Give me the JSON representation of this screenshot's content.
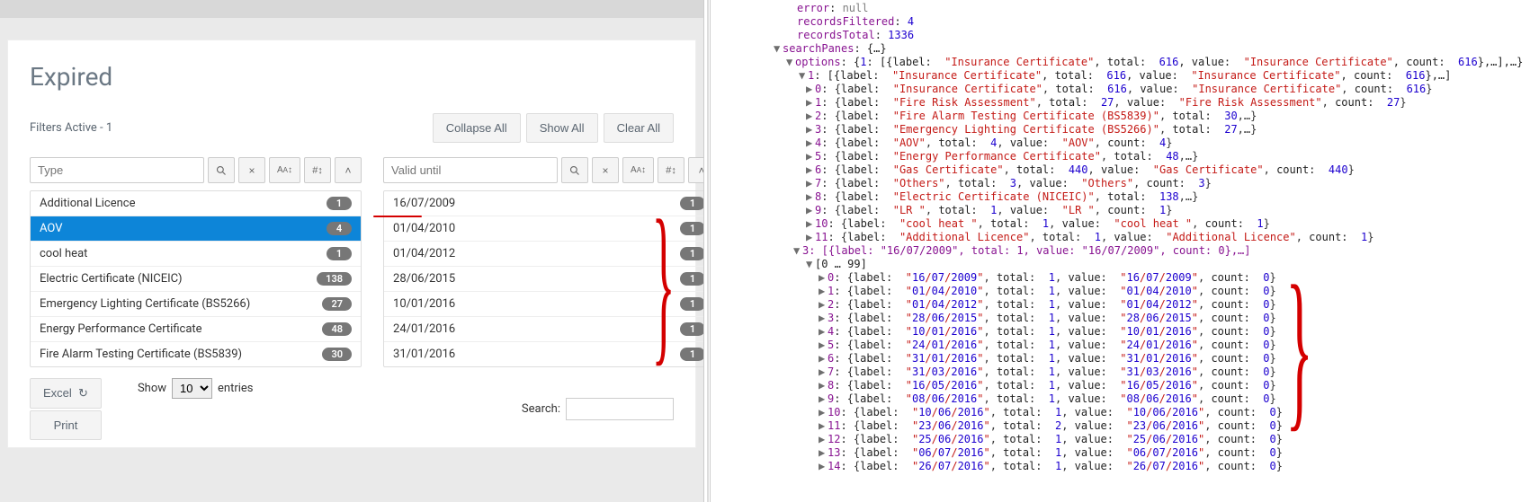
{
  "page": {
    "title": "Expired",
    "filters_active_label": "Filters Active - 1",
    "buttons": {
      "collapse": "Collapse All",
      "show": "Show All",
      "clear": "Clear All"
    }
  },
  "panes": {
    "type": {
      "placeholder": "Type",
      "items": [
        {
          "label": "Additional Licence",
          "count": 1
        },
        {
          "label": "AOV",
          "count": 4,
          "selected": true
        },
        {
          "label": "cool heat",
          "count": 1
        },
        {
          "label": "Electric Certificate (NICEIC)",
          "count": 138
        },
        {
          "label": "Emergency Lighting Certificate (BS5266)",
          "count": 27
        },
        {
          "label": "Energy Performance Certificate",
          "count": 48
        },
        {
          "label": "Fire Alarm Testing Certificate (BS5839)",
          "count": 30
        }
      ]
    },
    "valid": {
      "placeholder": "Valid until",
      "items": [
        {
          "label": "16/07/2009",
          "count": 1
        },
        {
          "label": "01/04/2010",
          "count": 1
        },
        {
          "label": "01/04/2012",
          "count": 1
        },
        {
          "label": "28/06/2015",
          "count": 1
        },
        {
          "label": "10/01/2016",
          "count": 1
        },
        {
          "label": "24/01/2016",
          "count": 1
        },
        {
          "label": "31/01/2016",
          "count": 1
        }
      ]
    },
    "sort_icons": {
      "clear": "×",
      "alpha": "A",
      "num": "#",
      "arrow": "˄"
    }
  },
  "table": {
    "excel": "Excel",
    "print": "Print",
    "show": "Show",
    "entries": "entries",
    "page_sizes": [
      "10"
    ],
    "search": "Search:"
  },
  "json": {
    "top": [
      {
        "indent": 4,
        "k": "error",
        "v": "null",
        "t": "null"
      },
      {
        "indent": 4,
        "k": "recordsFiltered",
        "v": "4",
        "t": "num"
      },
      {
        "indent": 4,
        "k": "recordsTotal",
        "v": "1336",
        "t": "num"
      },
      {
        "indent": 3,
        "arrow": "▼",
        "k": "searchPanes",
        "suffix": ": {…}"
      },
      {
        "indent": 4,
        "arrow": "▼",
        "k": "options",
        "suffix": ": {1: [{label: \"Insurance Certificate\", total: 616, value: \"Insurance Certificate\", count: 616},…],…}"
      },
      {
        "indent": 5,
        "arrow": "▼",
        "k": "1",
        "suffix": ": [{label: \"Insurance Certificate\", total: 616, value: \"Insurance Certificate\", count: 616},…]"
      }
    ],
    "opts1": [
      {
        "idx": 0,
        "label": "Insurance Certificate",
        "total": 616,
        "value": "Insurance Certificate",
        "count": 616,
        "trunc": false
      },
      {
        "idx": 1,
        "label": "Fire Risk Assessment",
        "total": 27,
        "value": "Fire Risk Assessment",
        "count": 27,
        "trunc": false
      },
      {
        "idx": 2,
        "label": "Fire Alarm Testing Certificate (BS5839)",
        "total": 30,
        "trunc": true
      },
      {
        "idx": 3,
        "label": "Emergency Lighting Certificate (BS5266)",
        "total": 27,
        "trunc": true
      },
      {
        "idx": 4,
        "label": "AOV",
        "total": 4,
        "value": "AOV",
        "count": 4,
        "trunc": false
      },
      {
        "idx": 5,
        "label": "Energy Performance Certificate",
        "total": 48,
        "value": "Energy Performance Certificate",
        "trunc": true
      },
      {
        "idx": 6,
        "label": "Gas Certificate",
        "total": 440,
        "value": "Gas Certificate",
        "count": 440,
        "trunc": false
      },
      {
        "idx": 7,
        "label": "Others",
        "total": 3,
        "value": "Others",
        "count": 3,
        "trunc": false
      },
      {
        "idx": 8,
        "label": "Electric Certificate (NICEIC)",
        "total": 138,
        "value": "Electric Certificate (NICEIC)",
        "trunc": true
      },
      {
        "idx": 9,
        "label": "LR ",
        "total": 1,
        "value": "LR ",
        "count": 1,
        "trunc": false
      },
      {
        "idx": 10,
        "label": "cool heat ",
        "total": 1,
        "value": "cool heat ",
        "count": 1,
        "trunc": false
      },
      {
        "idx": 11,
        "label": "Additional Licence",
        "total": 1,
        "value": "Additional Licence",
        "count": 1,
        "trunc": false
      }
    ],
    "group3_header": "3: [{label: \"16/07/2009\", total: 1, value: \"16/07/2009\", count: 0},…]",
    "group3_range": "[0 … 99]",
    "opts3": [
      {
        "idx": 0,
        "label": "16/07/2009",
        "total": 1,
        "count": 0
      },
      {
        "idx": 1,
        "label": "01/04/2010",
        "total": 1,
        "count": 0
      },
      {
        "idx": 2,
        "label": "01/04/2012",
        "total": 1,
        "count": 0
      },
      {
        "idx": 3,
        "label": "28/06/2015",
        "total": 1,
        "count": 0
      },
      {
        "idx": 4,
        "label": "10/01/2016",
        "total": 1,
        "count": 0
      },
      {
        "idx": 5,
        "label": "24/01/2016",
        "total": 1,
        "count": 0
      },
      {
        "idx": 6,
        "label": "31/01/2016",
        "total": 1,
        "count": 0
      },
      {
        "idx": 7,
        "label": "31/03/2016",
        "total": 1,
        "count": 0
      },
      {
        "idx": 8,
        "label": "16/05/2016",
        "total": 1,
        "count": 0
      },
      {
        "idx": 9,
        "label": "08/06/2016",
        "total": 1,
        "count": 0
      },
      {
        "idx": 10,
        "label": "10/06/2016",
        "total": 1,
        "count": 0
      },
      {
        "idx": 11,
        "label": "23/06/2016",
        "total": 2,
        "count": 0
      },
      {
        "idx": 12,
        "label": "25/06/2016",
        "total": 1,
        "count": 0
      },
      {
        "idx": 13,
        "label": "06/07/2016",
        "total": 1,
        "count": 0
      },
      {
        "idx": 14,
        "label": "26/07/2016",
        "total": 1,
        "count": 0
      }
    ]
  }
}
